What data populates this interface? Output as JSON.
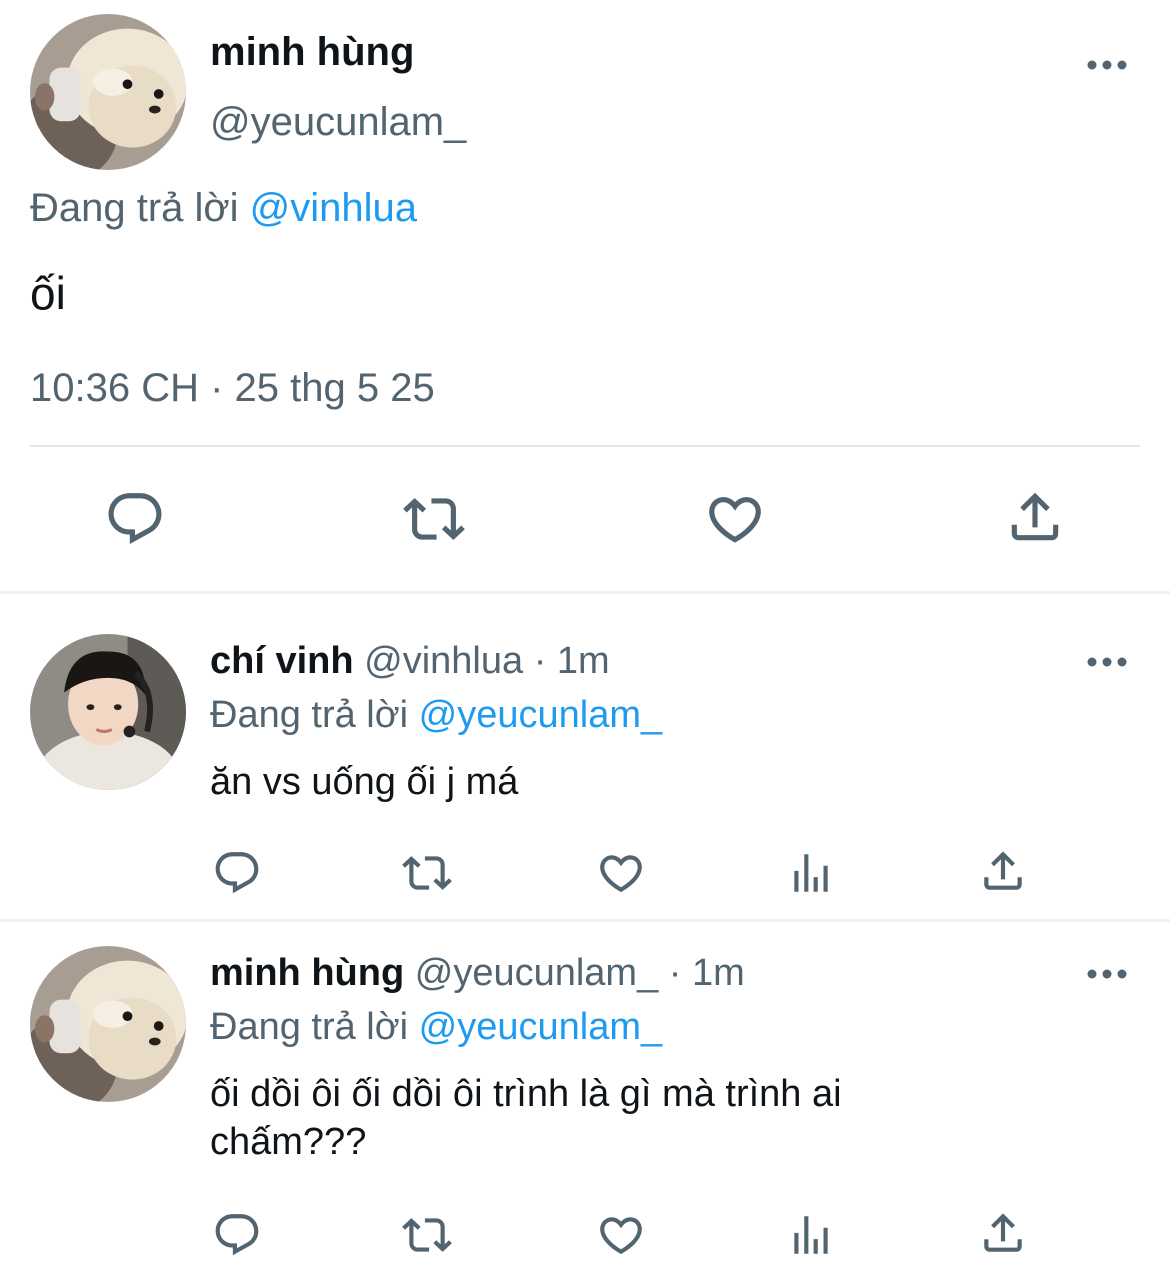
{
  "main_tweet": {
    "author_name": "minh hùng",
    "author_handle": "@yeucunlam_",
    "replying_prefix": "Đang trả lời",
    "replying_to": "@vinhlua",
    "text": "ối",
    "timestamp": "10:36 CH · 25 thg 5 25",
    "actions": [
      "reply-icon",
      "retweet-icon",
      "like-icon",
      "share-icon"
    ]
  },
  "replies": [
    {
      "author_name": "chí vinh",
      "author_handle": "@vinhlua",
      "time": "· 1m",
      "replying_prefix": "Đang trả lời",
      "replying_to": "@yeucunlam_",
      "text": "ăn vs uống ối j má",
      "actions": [
        "reply-icon",
        "retweet-icon",
        "like-icon",
        "analytics-icon",
        "share-icon"
      ]
    },
    {
      "author_name": "minh hùng",
      "author_handle": "@yeucunlam_",
      "time": "· 1m",
      "replying_prefix": "Đang trả lời",
      "replying_to": "@yeucunlam_",
      "text_line1": "ối dồi ôi ối dồi ôi trình là gì mà trình ai",
      "text_line2": "chấm???",
      "actions": [
        "reply-icon",
        "retweet-icon",
        "like-icon",
        "analytics-icon",
        "share-icon"
      ]
    }
  ],
  "colors": {
    "text": "#0f1419",
    "secondary": "#536471",
    "mention": "#1d9bf0",
    "divider": "#e1e6ea"
  }
}
